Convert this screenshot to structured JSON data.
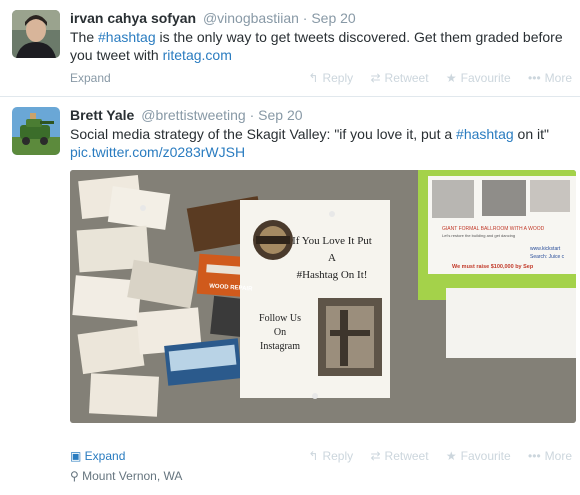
{
  "tweets": [
    {
      "fullname": "irvan cahya sofyan",
      "username": "@vinogbastiian",
      "separator": "·",
      "timestamp": "Sep 20",
      "body": {
        "pre": "The ",
        "hashtag": "#hashtag",
        "mid": " is the only way to get tweets discovered. Get them graded before you tweet with ",
        "link": "ritetag.com"
      },
      "expand": "Expand",
      "actions": {
        "reply": "Reply",
        "retweet": "Retweet",
        "favourite": "Favourite",
        "more": "More"
      }
    },
    {
      "fullname": "Brett Yale",
      "username": "@brettistweeting",
      "separator": "·",
      "timestamp": "Sep 20",
      "body": {
        "pre": "Social media strategy of the Skagit Valley: \"if you love it, put a ",
        "hashtag": "#hashtag",
        "post": " on it\"",
        "link": "pic.twitter.com/z0283rWJSH"
      },
      "photo": {
        "sign_lines": [
          "If You Love It Put",
          "A",
          "#Hashtag On It!"
        ],
        "follow_lines": [
          "Follow Us",
          "On",
          "Instagram"
        ],
        "flyer_lines": [
          "GIANT FORMAL BALLROOM WITH A WOOD",
          "Let's restore the building and get dancing",
          "www.kickstart",
          "Search: Juice c",
          "We must raise $100,000 by Sep"
        ],
        "card_text": "WOOD REPAIR"
      },
      "expand": "Expand",
      "location": "Mount Vernon, WA",
      "actions": {
        "reply": "Reply",
        "retweet": "Retweet",
        "favourite": "Favourite",
        "more": "More"
      }
    }
  ],
  "colors": {
    "link": "#2a7cc0",
    "muted": "#8899a6",
    "action": "#ccd6dd"
  },
  "icons": [
    "reply-icon",
    "retweet-icon",
    "star-icon",
    "more-dots-icon",
    "photo-icon",
    "location-pin-icon"
  ]
}
